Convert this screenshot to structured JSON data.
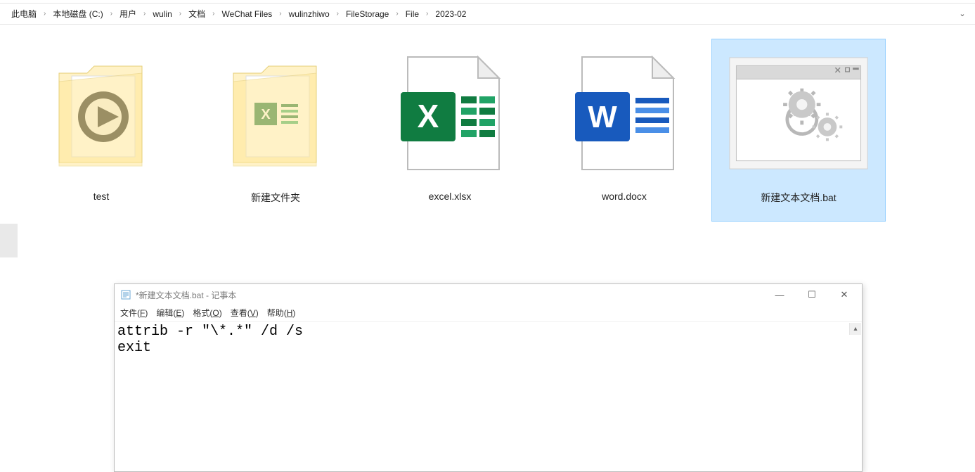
{
  "breadcrumb": {
    "items": [
      "此电脑",
      "本地磁盘 (C:)",
      "用户",
      "wulin",
      "文档",
      "WeChat Files",
      "wulinzhiwo",
      "FileStorage",
      "File",
      "2023-02"
    ]
  },
  "files": [
    {
      "name": "test",
      "type": "folder-media",
      "selected": false
    },
    {
      "name": "新建文件夹",
      "type": "folder-files",
      "selected": false
    },
    {
      "name": "excel.xlsx",
      "type": "excel",
      "selected": false
    },
    {
      "name": "word.docx",
      "type": "word",
      "selected": false
    },
    {
      "name": "新建文本文档.bat",
      "type": "bat",
      "selected": true
    }
  ],
  "notepad": {
    "title": "*新建文本文档.bat - 记事本",
    "menu": {
      "file": "文件(F)",
      "edit": "编辑(E)",
      "format": "格式(O)",
      "view": "查看(V)",
      "help": "帮助(H)"
    },
    "content": "attrib -r \"\\*.*\" /d /s\nexit"
  }
}
